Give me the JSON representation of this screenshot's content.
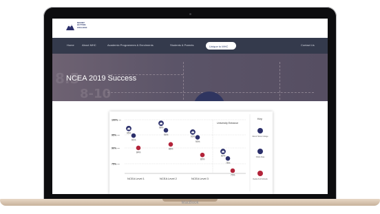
{
  "device": {
    "brand": "MacBook"
  },
  "site": {
    "logo_lines": [
      "MOUNT",
      "HUTTON",
      "COLLEGE"
    ],
    "nav": {
      "items": [
        "Home",
        "About MHC",
        "Academic Programmes & Enrolments",
        "Students & Parents",
        "Unique to MHC",
        "Contact Us"
      ],
      "active": "Unique to MHC"
    },
    "hero": {
      "title": "NCEA 2019 Success",
      "background_numbers": [
        "8.5",
        "8-10"
      ]
    }
  },
  "chart_data": {
    "type": "scatter",
    "y_ticks": [
      "100% —",
      "95% —",
      "90% —",
      "75% —"
    ],
    "x_groups": [
      "NCEA Level 1",
      "NCEA Level 2",
      "NCEA Level 3",
      "University Entrance"
    ],
    "series": [
      {
        "name": "Mount Hutton College",
        "marker": "navy-badge",
        "points": [
          {
            "group": "NCEA Level 1",
            "label": "95%"
          },
          {
            "group": "NCEA Level 2",
            "label": "98%"
          },
          {
            "group": "NCEA Level 3",
            "label": "93%"
          },
          {
            "group": "University Entrance",
            "label": "82%"
          }
        ]
      },
      {
        "name": "NCEA Pass",
        "marker": "navy-dot",
        "points": [
          {
            "group": "NCEA Level 1",
            "label": "91%"
          },
          {
            "group": "NCEA Level 2",
            "label": "94%"
          },
          {
            "group": "NCEA Level 3",
            "label": "90%"
          },
          {
            "group": "University Entrance",
            "label": "78%"
          }
        ]
      },
      {
        "name": "Decile 8-10 Schools",
        "marker": "red-dot",
        "points": [
          {
            "group": "NCEA Level 1",
            "label": "84%"
          },
          {
            "group": "NCEA Level 2",
            "label": "86%"
          },
          {
            "group": "NCEA Level 3",
            "label": "80%"
          },
          {
            "group": "University Entrance",
            "label": "70%"
          }
        ]
      }
    ],
    "key": {
      "title": "Key",
      "entries": [
        "Mount Hutton College",
        "NCEA Pass",
        "Decile 8-10 Schools"
      ]
    },
    "colors": {
      "navy": "#2b2f6b",
      "red": "#b3243a"
    }
  }
}
